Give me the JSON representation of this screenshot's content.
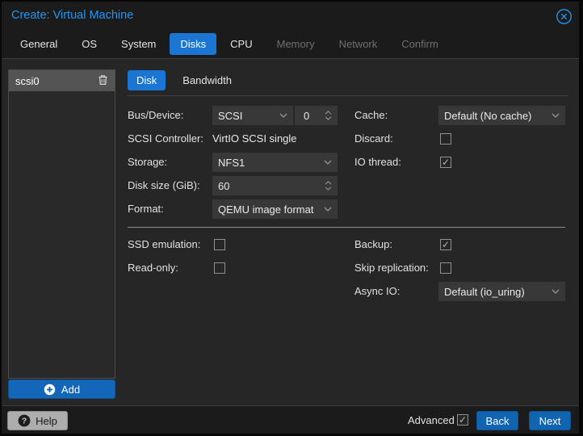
{
  "window": {
    "title": "Create: Virtual Machine"
  },
  "tabs": [
    {
      "label": "General",
      "state": "normal"
    },
    {
      "label": "OS",
      "state": "normal"
    },
    {
      "label": "System",
      "state": "normal"
    },
    {
      "label": "Disks",
      "state": "active"
    },
    {
      "label": "CPU",
      "state": "normal"
    },
    {
      "label": "Memory",
      "state": "disabled"
    },
    {
      "label": "Network",
      "state": "disabled"
    },
    {
      "label": "Confirm",
      "state": "disabled"
    }
  ],
  "disk_list": {
    "items": [
      {
        "label": "scsi0",
        "selected": true
      }
    ],
    "add_label": "Add"
  },
  "subtabs": [
    {
      "label": "Disk",
      "active": true
    },
    {
      "label": "Bandwidth",
      "active": false
    }
  ],
  "form": {
    "bus_device": {
      "label": "Bus/Device:",
      "bus_value": "SCSI",
      "device_value": "0"
    },
    "scsi_controller": {
      "label": "SCSI Controller:",
      "value": "VirtIO SCSI single"
    },
    "storage": {
      "label": "Storage:",
      "value": "NFS1"
    },
    "disk_size": {
      "label": "Disk size (GiB):",
      "value": "60"
    },
    "format": {
      "label": "Format:",
      "value": "QEMU image format"
    },
    "cache": {
      "label": "Cache:",
      "value": "Default (No cache)"
    },
    "discard": {
      "label": "Discard:",
      "checked": false,
      "mark": ""
    },
    "io_thread": {
      "label": "IO thread:",
      "checked": true,
      "mark": "✓"
    },
    "ssd_emulation": {
      "label": "SSD emulation:",
      "checked": false,
      "mark": ""
    },
    "read_only": {
      "label": "Read-only:",
      "checked": false,
      "mark": ""
    },
    "backup": {
      "label": "Backup:",
      "checked": true,
      "mark": "✓"
    },
    "skip_replication": {
      "label": "Skip replication:",
      "checked": false,
      "mark": ""
    },
    "async_io": {
      "label": "Async IO:",
      "value": "Default (io_uring)"
    }
  },
  "footer": {
    "help_label": "Help",
    "advanced_label": "Advanced",
    "advanced_checked": true,
    "advanced_mark": "✓",
    "back_label": "Back",
    "next_label": "Next"
  },
  "colors": {
    "accent_tab": "#1a76d2",
    "accent_button": "#1165b0",
    "title_blue": "#2196f3"
  }
}
